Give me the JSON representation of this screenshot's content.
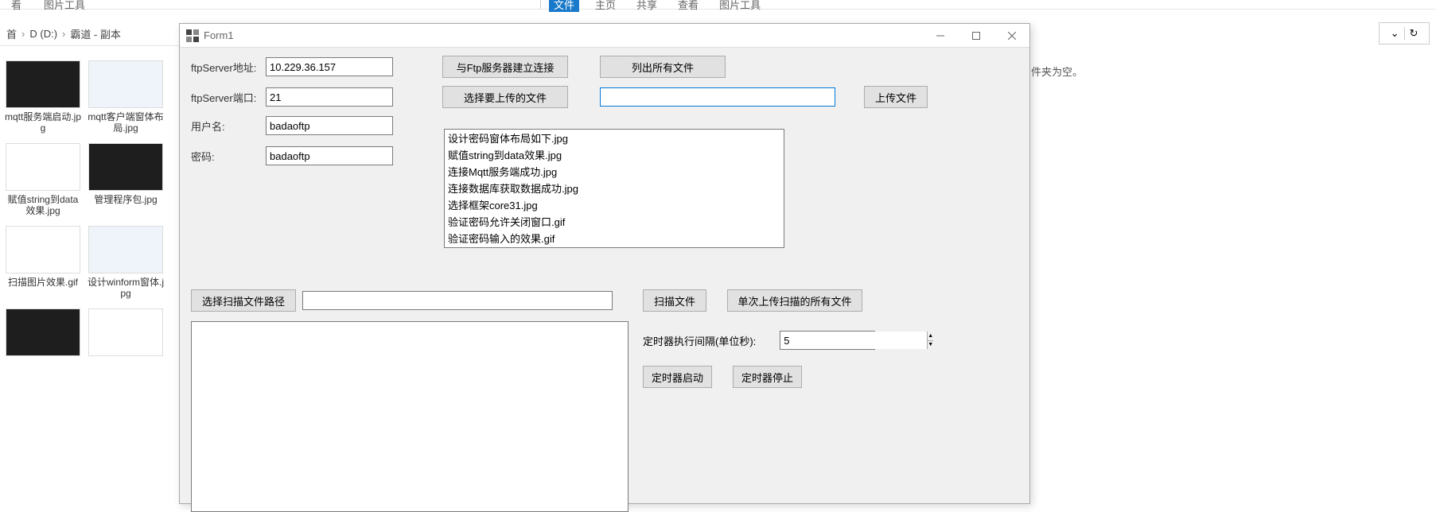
{
  "explorer_left": {
    "tabs": [
      "看",
      "图片工具"
    ],
    "breadcrumb": [
      "首",
      "D (D:)",
      "霸道 - 副本"
    ],
    "thumbs": [
      {
        "label": "mqtt服务端启动.jpg",
        "style": "dark"
      },
      {
        "label": "mqtt客户端窗体布局.jpg",
        "style": "light"
      },
      {
        "label": "赋值string到data效果.jpg",
        "style": "white"
      },
      {
        "label": "管理程序包.jpg",
        "style": "dark"
      },
      {
        "label": "扫描图片效果.gif",
        "style": "white"
      },
      {
        "label": "设计winform窗体.jpg",
        "style": "light"
      }
    ]
  },
  "explorer_right": {
    "tabs": [
      "文件",
      "主页",
      "共享",
      "查看",
      "图片工具"
    ],
    "empty_message": "件夹为空。"
  },
  "form1": {
    "title": "Form1",
    "labels": {
      "ftpServerAddr": "ftpServer地址:",
      "ftpServerPort": "ftpServer端口:",
      "username": "用户名:",
      "password": "密码:"
    },
    "values": {
      "ftpServerAddr": "10.229.36.157",
      "ftpServerPort": "21",
      "username": "badaoftp",
      "password": "badaoftp",
      "timerInterval": "5"
    },
    "buttons": {
      "connectFtp": "与Ftp服务器建立连接",
      "listAllFiles": "列出所有文件",
      "chooseUploadFile": "选择要上传的文件",
      "uploadFile": "上传文件",
      "chooseScanPath": "选择扫描文件路径",
      "scanFiles": "扫描文件",
      "uploadAllScanned": "单次上传扫描的所有文件",
      "timerStart": "定时器启动",
      "timerStop": "定时器停止"
    },
    "timerLabel": "定时器执行间隔(单位秒):",
    "fileList": [
      "设计密码窗体布局如下.jpg",
      "赋值string到data效果.jpg",
      "连接Mqtt服务端成功.jpg",
      "连接数据库获取数据成功.jpg",
      "选择框架core31.jpg",
      "验证密码允许关闭窗口.gif",
      "验证密码输入的效果.gif"
    ]
  }
}
